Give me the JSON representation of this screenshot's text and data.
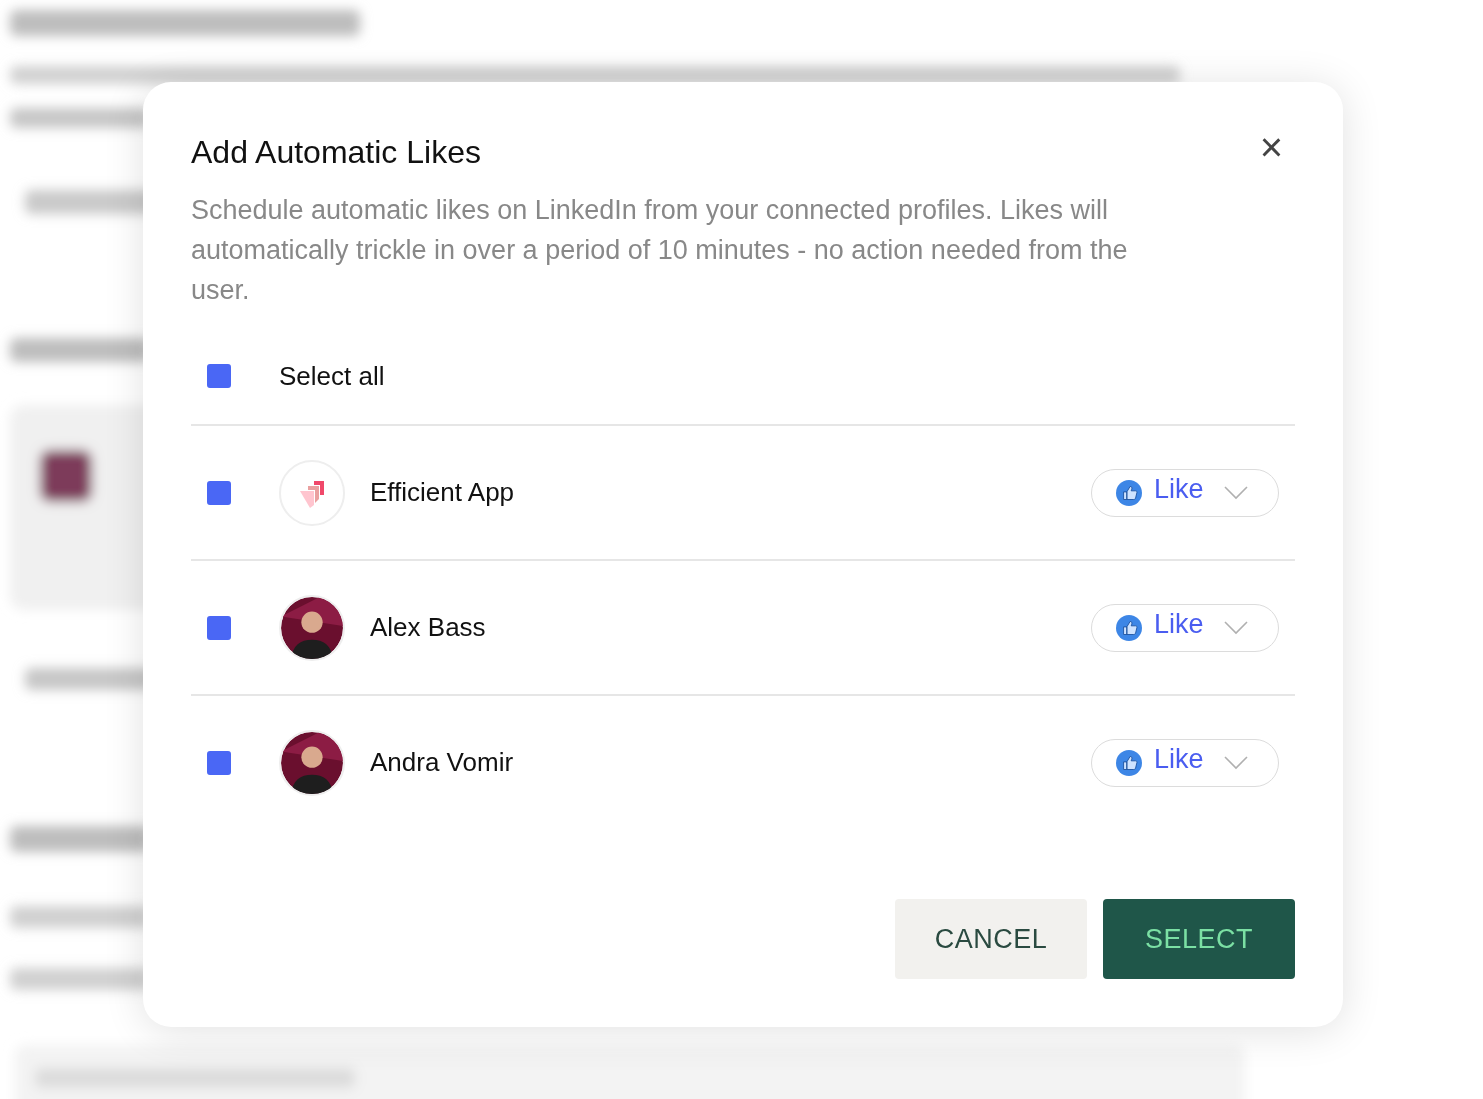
{
  "dialog": {
    "title": "Add Automatic Likes",
    "close": "×",
    "description": "Schedule automatic likes on LinkedIn from your connected profiles. Likes will automatically trickle in over a period of 10 minutes - no action needed from the user.",
    "select_all": {
      "label": "Select all",
      "checked": true
    },
    "profiles": [
      {
        "name": "Efficient App",
        "kind": "logo",
        "checked": true,
        "reaction": "Like"
      },
      {
        "name": "Alex Bass",
        "kind": "photo",
        "checked": true,
        "reaction": "Like"
      },
      {
        "name": "Andra Vomir",
        "kind": "photo",
        "checked": true,
        "reaction": "Like"
      }
    ],
    "buttons": [
      {
        "label": "CANCEL",
        "kind": "secondary"
      },
      {
        "label": "SELECT",
        "kind": "primary"
      }
    ]
  }
}
